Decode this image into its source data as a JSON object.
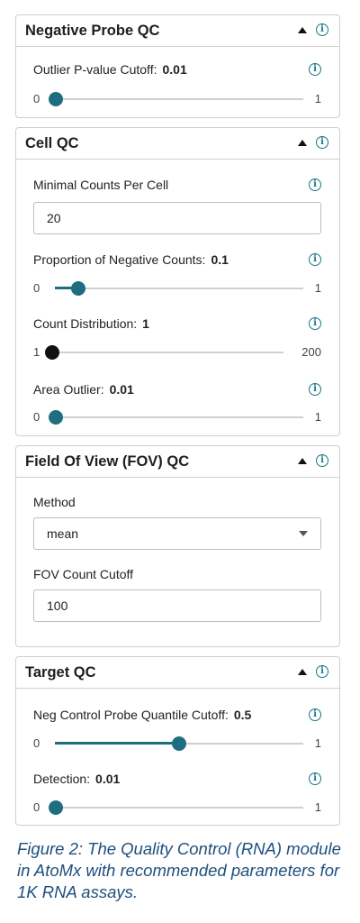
{
  "colors": {
    "accent": "#1f6e80",
    "caption": "#1d4f7d",
    "border": "#cfcfcf"
  },
  "icons": {
    "info": "info-icon",
    "collapse": "triangle-up-icon",
    "dropdown": "chevron-down-icon"
  },
  "panels": [
    {
      "title": "Negative Probe QC",
      "rows": [
        {
          "label": "Outlier P-value Cutoff:",
          "value": "0.01",
          "min": "0",
          "max": "1",
          "fraction": 0.0
        }
      ]
    },
    {
      "title": "Cell QC",
      "input": {
        "label": "Minimal Counts Per Cell",
        "value": "20"
      },
      "rows": [
        {
          "label": "Proportion of Negative Counts:",
          "value": "0.1",
          "min": "0",
          "max": "1",
          "fraction": 0.1
        },
        {
          "label": "Count Distribution:",
          "value": "1",
          "min": "1",
          "max": "200",
          "fraction": 0.0
        },
        {
          "label": "Area Outlier:",
          "value": "0.01",
          "min": "0",
          "max": "1",
          "fraction": 0.0
        }
      ]
    },
    {
      "title": "Field Of View (FOV) QC",
      "method": {
        "label": "Method",
        "selected": "mean"
      },
      "cutoff": {
        "label": "FOV Count Cutoff",
        "value": "100"
      }
    },
    {
      "title": "Target QC",
      "rows": [
        {
          "label": "Neg Control Probe Quantile Cutoff:",
          "value": "0.5",
          "min": "0",
          "max": "1",
          "fraction": 0.5
        },
        {
          "label": "Detection:",
          "value": "0.01",
          "min": "0",
          "max": "1",
          "fraction": 0.0
        }
      ]
    }
  ],
  "caption": "Figure 2: The Quality Control (RNA) module in AtoMx with recommended parameters for 1K RNA assays."
}
